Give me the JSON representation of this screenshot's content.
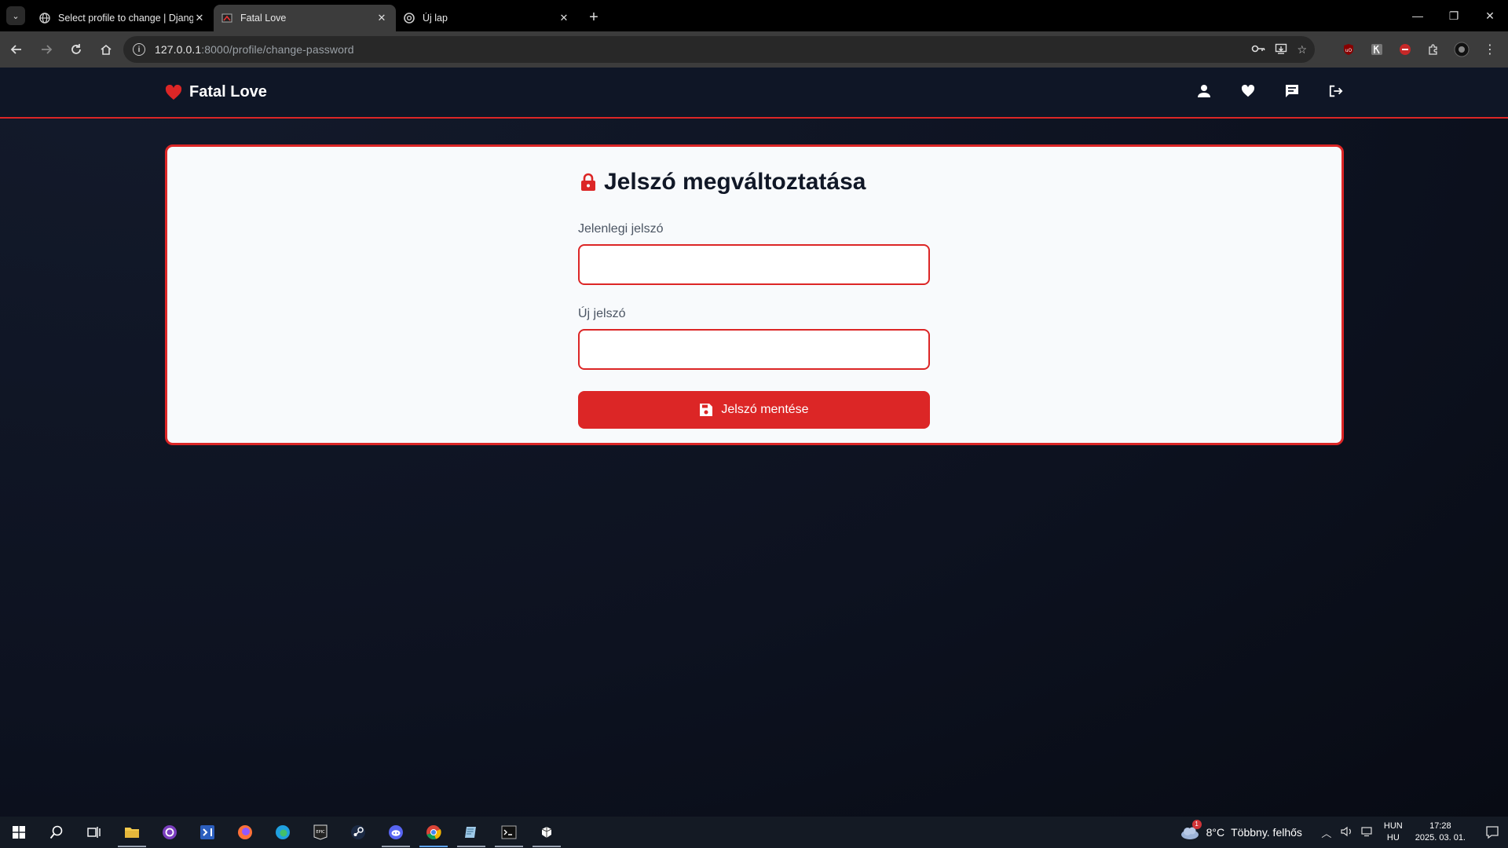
{
  "browser": {
    "tabs": [
      {
        "title": "Select profile to change | Djang",
        "active": false
      },
      {
        "title": "Fatal Love",
        "active": true
      },
      {
        "title": "Új lap",
        "active": false
      }
    ],
    "url_host": "127.0.0.1",
    "url_rest": ":8000/profile/change-password"
  },
  "site": {
    "brand": "Fatal Love",
    "accent": "#dc2626"
  },
  "form": {
    "title": "Jelszó megváltoztatása",
    "current_password_label": "Jelenlegi jelszó",
    "new_password_label": "Új jelszó",
    "submit_label": "Jelszó mentése"
  },
  "taskbar": {
    "weather_temp": "8°C",
    "weather_desc": "Többny. felhős",
    "weather_badge": "1",
    "lang_top": "HUN",
    "lang_bottom": "HU",
    "time": "17:28",
    "date": "2025. 03. 01."
  }
}
